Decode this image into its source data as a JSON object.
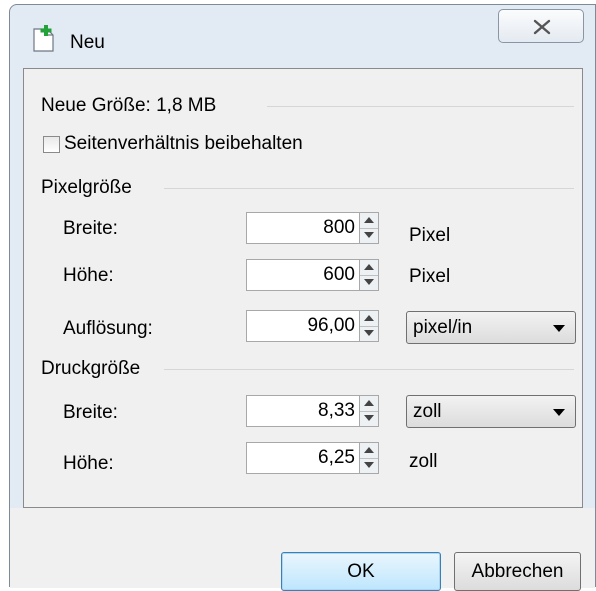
{
  "window": {
    "title": "Neu",
    "close_symbol": "x"
  },
  "size_info": "Neue Größe: 1,8 MB",
  "aspect_ratio": {
    "label": "Seitenverhältnis beibehalten",
    "checked": false
  },
  "pixel_size": {
    "heading": "Pixelgröße",
    "width": {
      "label": "Breite:",
      "value": "800",
      "unit": "Pixel"
    },
    "height": {
      "label": "Höhe:",
      "value": "600",
      "unit": "Pixel"
    },
    "resolution": {
      "label": "Auflösung:",
      "value": "96,00",
      "unit": "pixel/in"
    }
  },
  "print_size": {
    "heading": "Druckgröße",
    "width": {
      "label": "Breite:",
      "value": "8,33",
      "unit": "zoll"
    },
    "height": {
      "label": "Höhe:",
      "value": "6,25",
      "unit": "zoll"
    }
  },
  "buttons": {
    "ok": "OK",
    "cancel": "Abbrechen"
  },
  "icons": {
    "app": "new-document-icon",
    "close": "close-icon"
  }
}
